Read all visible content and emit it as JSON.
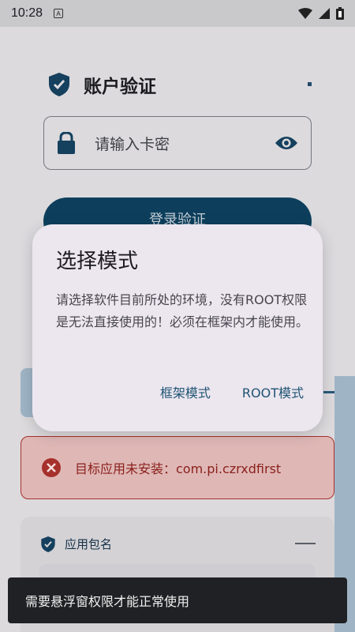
{
  "status_bar": {
    "time": "10:28",
    "notification_letter": "A"
  },
  "header": {
    "title": "账户验证"
  },
  "card_input": {
    "placeholder": "请输入卡密"
  },
  "login_button": {
    "label": "登录验证"
  },
  "dialog": {
    "title": "选择模式",
    "message": "请选择软件目前所处的环境，没有ROOT权限是无法直接使用的！必须在框架内才能使用。",
    "buttons": [
      "框架模式",
      "ROOT模式"
    ]
  },
  "error": {
    "text": "目标应用未安装：com.pi.czrxdfirst"
  },
  "package_card": {
    "label": "应用包名"
  },
  "toast": {
    "text": "需要悬浮窗权限才能正常使用"
  },
  "colors": {
    "primary": "#0d3f5c",
    "error": "#a5302c",
    "dialog_bg": "#ece6ef"
  },
  "icons": [
    "shield-check-icon",
    "lock-icon",
    "eye-icon",
    "error-x-icon",
    "wifi-icon",
    "signal-icon",
    "battery-icon"
  ]
}
